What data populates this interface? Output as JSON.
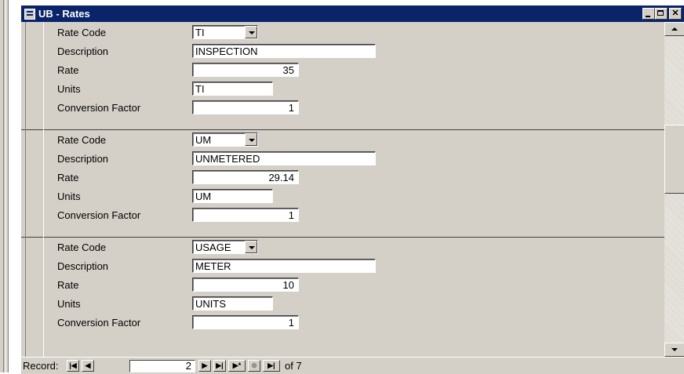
{
  "window": {
    "title": "UB - Rates"
  },
  "field_labels": {
    "rate_code": "Rate Code",
    "description": "Description",
    "rate": "Rate",
    "units": "Units",
    "conversion_factor": "Conversion Factor"
  },
  "records": [
    {
      "rate_code": "TI",
      "description": "INSPECTION",
      "rate": "35",
      "units": "TI",
      "conversion_factor": "1"
    },
    {
      "rate_code": "UM",
      "description": "UNMETERED",
      "rate": "29.14",
      "units": "UM",
      "conversion_factor": "1"
    },
    {
      "rate_code": "USAGE",
      "description": "METER",
      "rate": "10",
      "units": "UNITS",
      "conversion_factor": "1"
    }
  ],
  "navigation": {
    "record_label": "Record:",
    "current_record": "2",
    "of_text": "of 7",
    "buttons": [
      "first-record-icon",
      "previous-record-icon",
      "next-record-icon",
      "last-record-icon",
      "new-record-icon",
      "delete-record-icon",
      "filter-record-icon"
    ]
  }
}
